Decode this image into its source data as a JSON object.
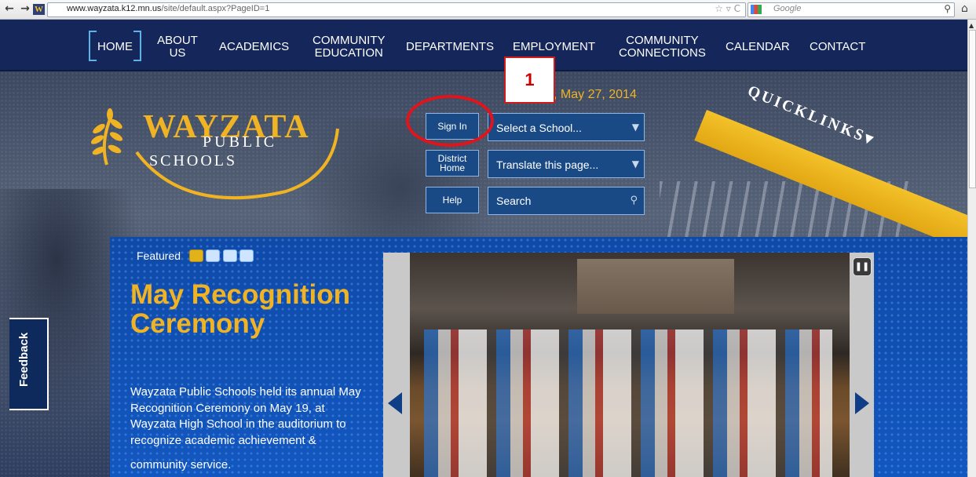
{
  "browser": {
    "url_host": "www.wayzata.k12.mn.us",
    "url_path": "/site/default.aspx?PageID=1",
    "search_placeholder": "Google",
    "favicon_letter": "W"
  },
  "nav": {
    "items": [
      {
        "label": "HOME"
      },
      {
        "label": "ABOUT\nUS"
      },
      {
        "label": "ACADEMICS"
      },
      {
        "label": "COMMUNITY\nEDUCATION"
      },
      {
        "label": "DEPARTMENTS"
      },
      {
        "label": "EMPLOYMENT"
      },
      {
        "label": "COMMUNITY\nCONNECTIONS"
      },
      {
        "label": "CALENDAR"
      },
      {
        "label": "CONTACT"
      }
    ]
  },
  "header": {
    "date": ", May 27, 2014",
    "sign_in": "Sign In",
    "district_home": "District\nHome",
    "help": "Help",
    "select_school": "Select a School...",
    "translate": "Translate this page...",
    "search_placeholder": "Search",
    "quicklinks": "QUICKLINKS▾",
    "annotation_number": "1"
  },
  "logo": {
    "wayzata": "WAYZATA",
    "public": "PUBLIC",
    "schools": "SCHOOLS"
  },
  "featured": {
    "label": "Featured",
    "title": "May Recognition Ceremony",
    "text": "Wayzata Public Schools held its annual May Recognition Ceremony on May 19, at Wayzata High School in the auditorium to recognize academic achievement &",
    "more": "community service.",
    "slides": 4,
    "active_slide": 1
  },
  "feedback": {
    "label": "Feedback"
  },
  "colors": {
    "nav_bg": "#14265a",
    "accent_gold": "#f0b323",
    "featured_blue": "#1257c0",
    "annotation_red": "#e0141b"
  }
}
